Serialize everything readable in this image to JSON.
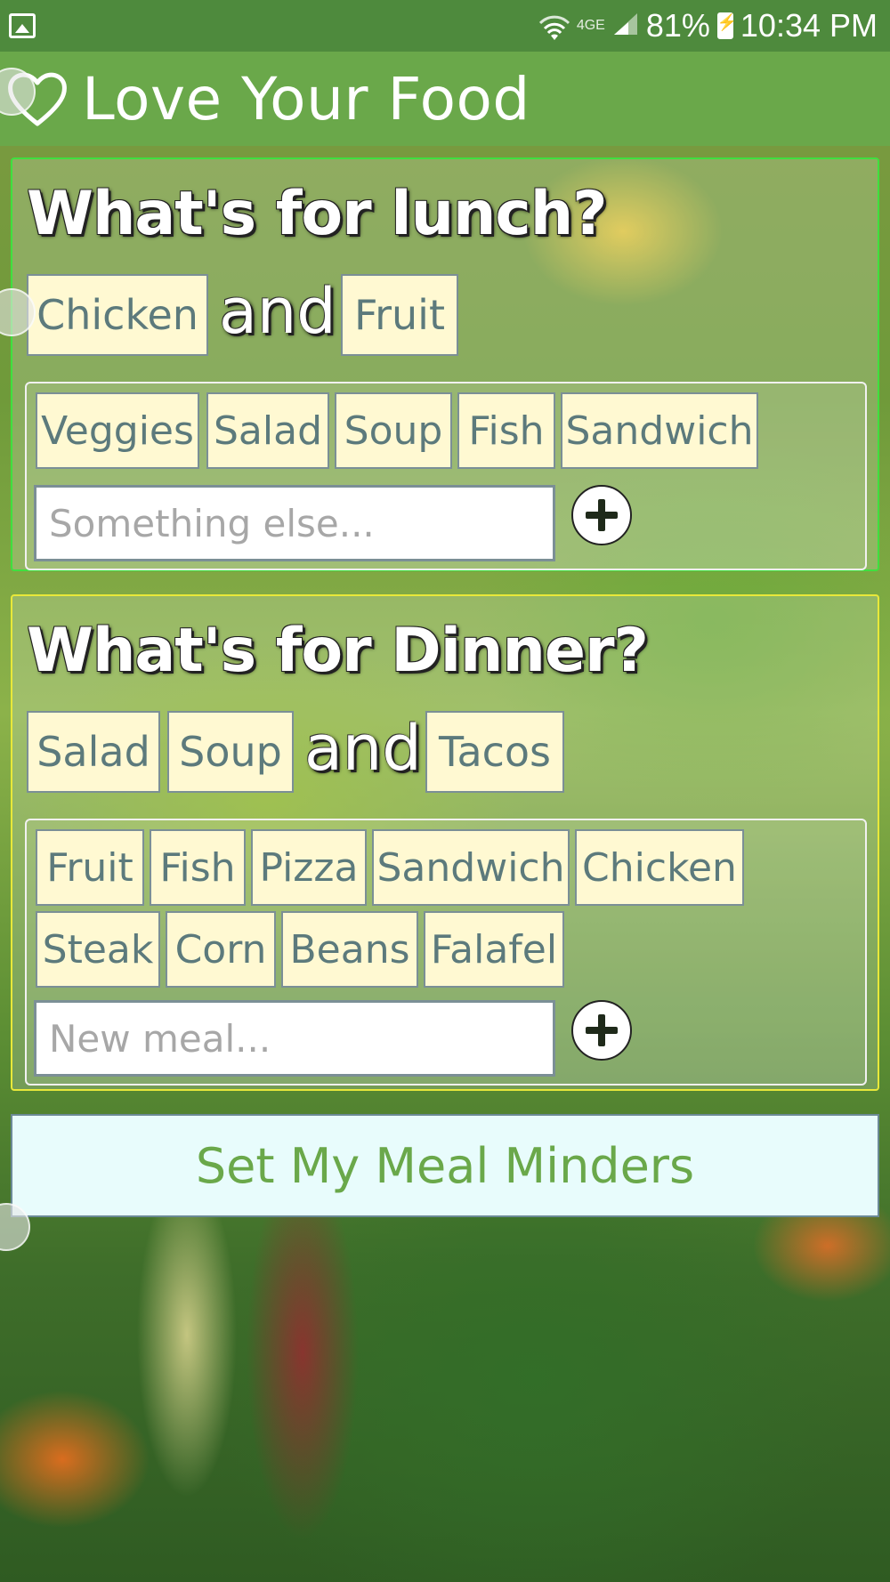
{
  "status_bar": {
    "network_label": "4GE",
    "battery": "81%",
    "time": "10:34 PM"
  },
  "app_bar": {
    "title": "Love Your Food",
    "icon": "heart-icon"
  },
  "lunch": {
    "heading": "What's for lunch?",
    "selected": [
      "Chicken",
      "Fruit"
    ],
    "joiner": "and",
    "options": [
      "Veggies",
      "Salad",
      "Soup",
      "Fish",
      "Sandwich"
    ],
    "input_placeholder": "Something else...",
    "add_icon": "plus-icon",
    "border_color": "#3fe03f"
  },
  "dinner": {
    "heading": "What's for Dinner?",
    "selected": [
      "Salad",
      "Soup",
      "Tacos"
    ],
    "joiner": "and",
    "options": [
      "Fruit",
      "Fish",
      "Pizza",
      "Sandwich",
      "Chicken",
      "Steak",
      "Corn",
      "Beans",
      "Falafel"
    ],
    "input_placeholder": "New meal...",
    "add_icon": "plus-icon",
    "border_color": "#e8e83a"
  },
  "set_button_label": "Set My Meal Minders",
  "colors": {
    "status_bar": "#4e8a3d",
    "app_bar": "#6aa84a",
    "chip_bg": "#fff9d2",
    "chip_text": "#5c7a7c",
    "button_bg": "#e8fcfc",
    "button_text": "#6aa84a"
  }
}
